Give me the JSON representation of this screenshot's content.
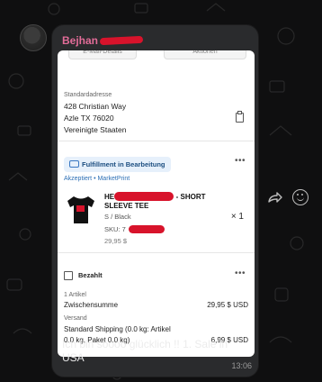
{
  "chat": {
    "sender": "Bejhan",
    "message_text": "Ich bin soooo glücklich !! 1. Sale in USA",
    "time": "13:06"
  },
  "panel": {
    "top_buttons": [
      "E-Mail-Details",
      "Aktionen"
    ],
    "address": {
      "label": "Standardadresse",
      "line1": "428 Christian Way",
      "line2": "Azle TX 76020",
      "line3": "Vereinigte Staaten"
    },
    "fulfillment": {
      "badge": "Fulfillment in Bearbeitung",
      "accepted": "Akzeptiert • MarketPrint",
      "product_prefix": "HE",
      "product_suffix": "- SHORT",
      "product_line2": "SLEEVE TEE",
      "variant": "S / Black",
      "sku_label": "SKU: 7",
      "price": "29,95 $",
      "qty": "× 1"
    },
    "payment": {
      "badge": "Bezahlt",
      "items_label": "1 Artikel",
      "subtotal_label": "Zwischensumme",
      "subtotal_value": "29,95 $ USD",
      "shipping_header": "Versand",
      "shipping_label_1": "Standard Shipping (0.0 kg: Artikel",
      "shipping_label_2": "0.0 kg, Paket 0.0 kg)",
      "shipping_value": "6,99 $ USD"
    }
  },
  "icons": {
    "more": "more-icon",
    "truck": "truck-icon",
    "clipboard": "clipboard-icon",
    "forward": "forward-icon",
    "emoji": "emoji-icon"
  }
}
